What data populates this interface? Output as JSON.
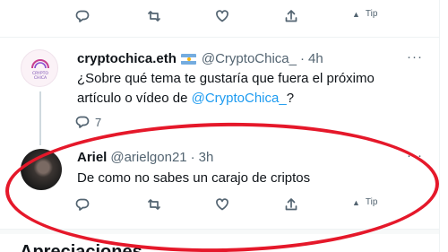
{
  "top_actions": {
    "tip_label": "Tip"
  },
  "tweet1": {
    "display_name": "cryptochica.eth",
    "handle": "@CryptoChica_",
    "sep": "·",
    "time": "4h",
    "text_part1": "¿Sobre qué tema te gustaría que fuera el próximo artículo o vídeo de ",
    "mention": "@CryptoChica_",
    "text_part2": "?",
    "reply_count": "7",
    "avatar_text_line1": "CRYPTO",
    "avatar_text_line2": "CHICA"
  },
  "tweet2": {
    "display_name": "Ariel",
    "handle": "@arielgon21",
    "sep": "·",
    "time": "3h",
    "text": "De como no sabes un carajo de criptos",
    "tip_label": "Tip"
  },
  "more_label": "···",
  "section": {
    "heading": "Apreciaciones"
  },
  "colors": {
    "accent": "#1d9bf0",
    "muted": "#536471",
    "annotation": "#e5182a"
  }
}
